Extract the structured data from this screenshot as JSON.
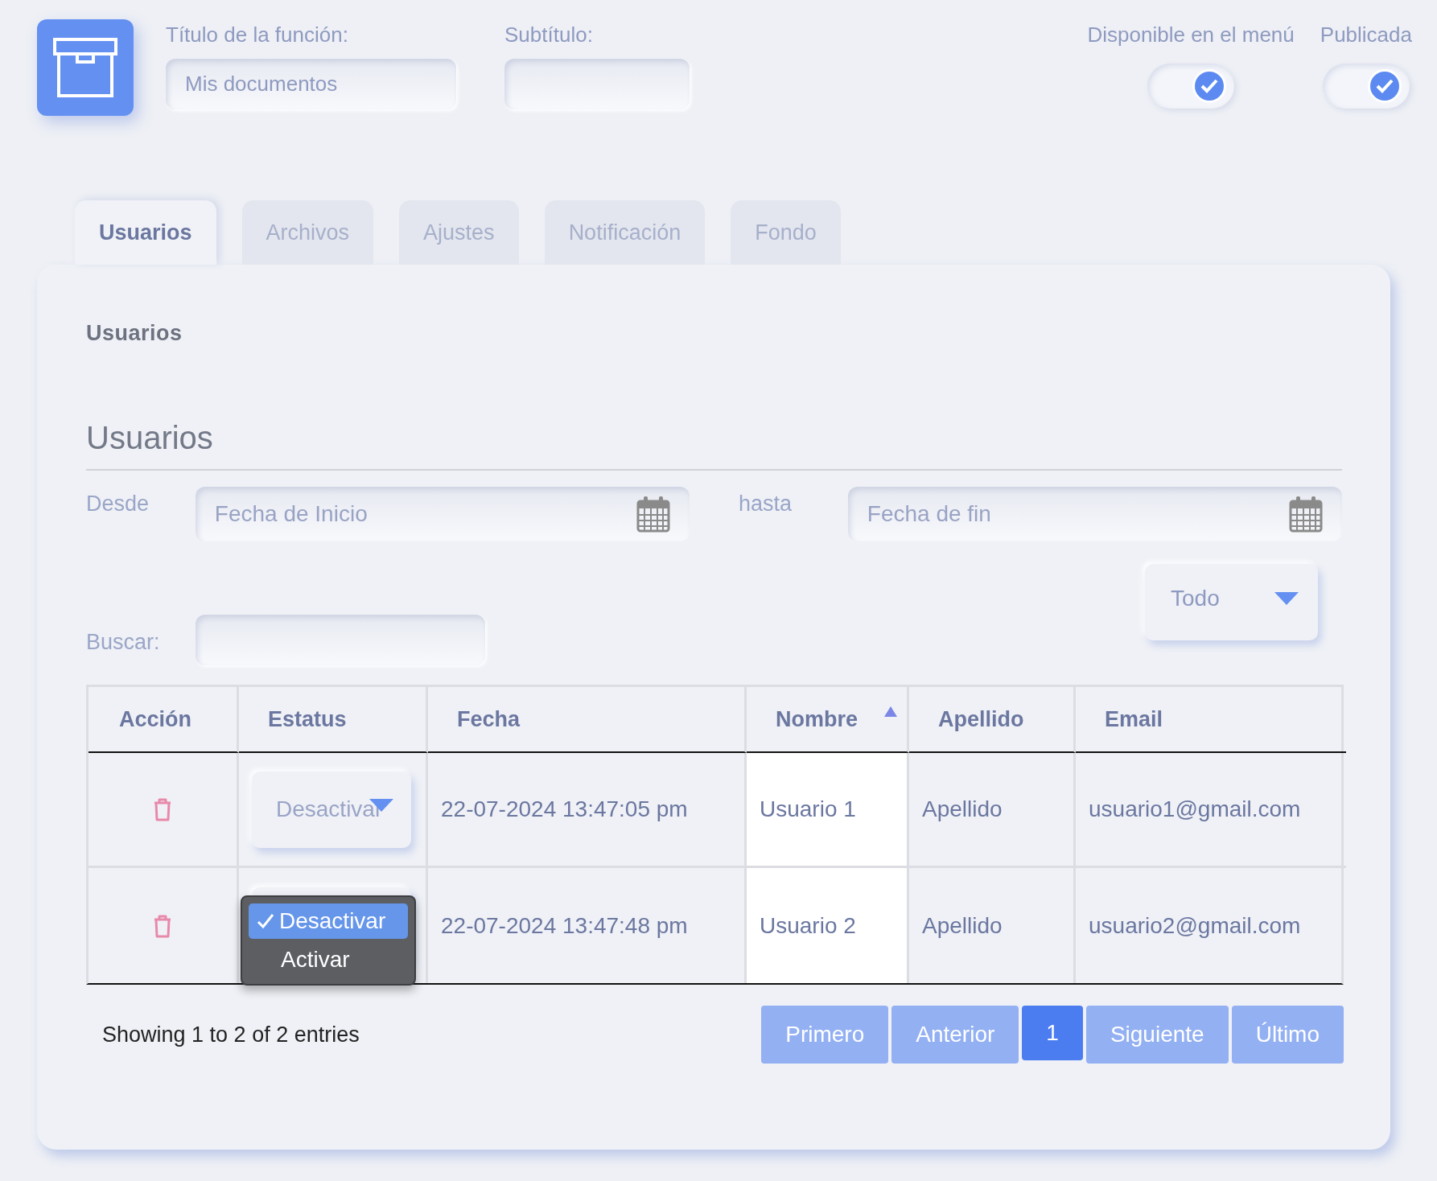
{
  "header": {
    "title_field": {
      "label": "Título de la función:",
      "value": "Mis documentos"
    },
    "subtitle_field": {
      "label": "Subtítulo:"
    },
    "toggles": [
      {
        "label": "Disponible en el menú",
        "checked": true
      },
      {
        "label": "Publicada",
        "checked": true
      }
    ]
  },
  "tabs": [
    {
      "label": "Usuarios",
      "selected": true
    },
    {
      "label": "Archivos",
      "selected": false
    },
    {
      "label": "Ajustes",
      "selected": false
    },
    {
      "label": "Notificación",
      "selected": false
    },
    {
      "label": "Fondo",
      "selected": false
    }
  ],
  "panel": {
    "heading": "Usuarios",
    "section_title": "Usuarios",
    "date_from": {
      "label": "Desde",
      "placeholder": "Fecha de Inicio"
    },
    "date_to": {
      "label": "hasta",
      "placeholder": "Fecha de fin"
    },
    "filter_select": {
      "value": "Todo"
    },
    "search": {
      "label": "Buscar:"
    },
    "table": {
      "columns": [
        {
          "label": "Acción",
          "sorted": false
        },
        {
          "label": "Estatus",
          "sorted": false
        },
        {
          "label": "Fecha",
          "sorted": false
        },
        {
          "label": "Nombre",
          "sorted": true
        },
        {
          "label": "Apellido",
          "sorted": false
        },
        {
          "label": "Email",
          "sorted": false
        }
      ],
      "rows": [
        {
          "status": {
            "value": "Desactivar",
            "open": false
          },
          "date": "22-07-2024 13:47:05 pm",
          "name": "Usuario 1",
          "surname": "Apellido",
          "email": "usuario1@gmail.com"
        },
        {
          "status": {
            "open": true,
            "options": [
              {
                "label": "Desactivar",
                "selected": true
              },
              {
                "label": "Activar",
                "selected": false
              }
            ]
          },
          "date": "22-07-2024 13:47:48 pm",
          "name": "Usuario 2",
          "surname": "Apellido",
          "email": "usuario2@gmail.com"
        }
      ]
    },
    "info": "Showing 1 to 2 of 2 entries",
    "pagination": [
      {
        "label": "Primero",
        "selected": false
      },
      {
        "label": "Anterior",
        "selected": false
      },
      {
        "label": "1",
        "selected": true
      },
      {
        "label": "Siguiente",
        "selected": false
      },
      {
        "label": "Último",
        "selected": false
      }
    ]
  }
}
